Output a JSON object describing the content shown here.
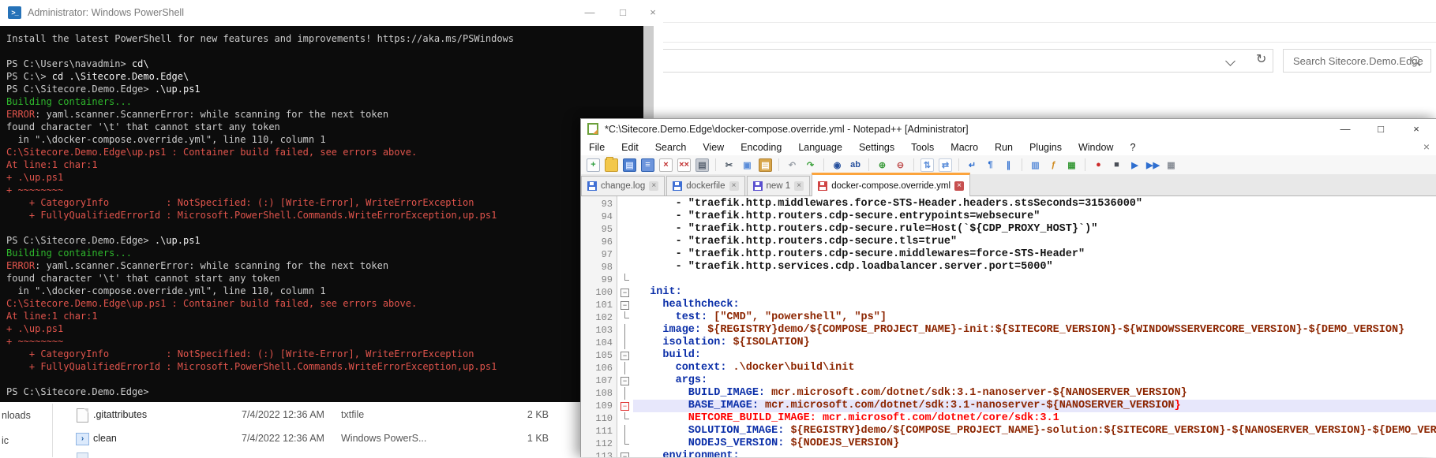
{
  "explorer_window": {
    "search_placeholder": "Search Sitecore.Demo.Edge",
    "refresh_icon_glyph": "↻",
    "nav_fragments": [
      "nloads",
      "ic"
    ],
    "files": [
      {
        "name": ".gitattributes",
        "date_modified": "7/4/2022 12:36 AM",
        "type": "txtfile",
        "size": "2 KB",
        "icon": "text-file-icon"
      },
      {
        "name": "clean",
        "date_modified": "7/4/2022 12:36 AM",
        "type": "Windows PowerS...",
        "size": "1 KB",
        "icon": "powershell-file-icon"
      }
    ]
  },
  "powershell_window": {
    "title": "Administrator: Windows PowerShell",
    "icon_glyph": ">_",
    "window_buttons": {
      "minimize": "—",
      "maximize": "□",
      "close": "×"
    },
    "console_lines": [
      [
        [
          "Install the latest PowerShell for new features and improvements! https://aka.ms/PSWindows",
          "w"
        ]
      ],
      [],
      [
        [
          "PS C:\\Users\\navadmin> ",
          "w"
        ],
        [
          "cd\\",
          "W"
        ]
      ],
      [
        [
          "PS C:\\> ",
          "w"
        ],
        [
          "cd .\\Sitecore.Demo.Edge\\",
          "W"
        ]
      ],
      [
        [
          "PS C:\\Sitecore.Demo.Edge> ",
          "w"
        ],
        [
          ".\\up.ps1",
          "W"
        ]
      ],
      [
        [
          "Building containers...",
          "g"
        ]
      ],
      [
        [
          "ERROR",
          "r"
        ],
        [
          ": yaml.scanner.ScannerError: while scanning for the next token",
          "w"
        ]
      ],
      [
        [
          "found character '\\t' that cannot start any token",
          "w"
        ]
      ],
      [
        [
          "  in \".\\docker-compose.override.yml\", line 110, column 1",
          "w"
        ]
      ],
      [
        [
          "C:\\Sitecore.Demo.Edge\\up.ps1 : Container build failed, see errors above.",
          "r"
        ]
      ],
      [
        [
          "At line:1 char:1",
          "r"
        ]
      ],
      [
        [
          "+ .\\up.ps1",
          "r"
        ]
      ],
      [
        [
          "+ ~~~~~~~~",
          "r"
        ]
      ],
      [
        [
          "    + CategoryInfo          : NotSpecified: (:) [Write-Error], WriteErrorException",
          "r"
        ]
      ],
      [
        [
          "    + FullyQualifiedErrorId : Microsoft.PowerShell.Commands.WriteErrorException,up.ps1",
          "r"
        ]
      ],
      [],
      [
        [
          "PS C:\\Sitecore.Demo.Edge> ",
          "w"
        ],
        [
          ".\\up.ps1",
          "W"
        ]
      ],
      [
        [
          "Building containers...",
          "g"
        ]
      ],
      [
        [
          "ERROR",
          "r"
        ],
        [
          ": yaml.scanner.ScannerError: while scanning for the next token",
          "w"
        ]
      ],
      [
        [
          "found character '\\t' that cannot start any token",
          "w"
        ]
      ],
      [
        [
          "  in \".\\docker-compose.override.yml\", line 110, column 1",
          "w"
        ]
      ],
      [
        [
          "C:\\Sitecore.Demo.Edge\\up.ps1 : Container build failed, see errors above.",
          "r"
        ]
      ],
      [
        [
          "At line:1 char:1",
          "r"
        ]
      ],
      [
        [
          "+ .\\up.ps1",
          "r"
        ]
      ],
      [
        [
          "+ ~~~~~~~~",
          "r"
        ]
      ],
      [
        [
          "    + CategoryInfo          : NotSpecified: (:) [Write-Error], WriteErrorException",
          "r"
        ]
      ],
      [
        [
          "    + FullyQualifiedErrorId : Microsoft.PowerShell.Commands.WriteErrorException,up.ps1",
          "r"
        ]
      ],
      [],
      [
        [
          "PS C:\\Sitecore.Demo.Edge>",
          "w"
        ]
      ]
    ]
  },
  "notepad_window": {
    "title": "*C:\\Sitecore.Demo.Edge\\docker-compose.override.yml - Notepad++ [Administrator]",
    "window_buttons": {
      "minimize": "—",
      "maximize": "□",
      "close": "×"
    },
    "menu_items": [
      "File",
      "Edit",
      "Search",
      "View",
      "Encoding",
      "Language",
      "Settings",
      "Tools",
      "Macro",
      "Run",
      "Plugins",
      "Window",
      "?"
    ],
    "menu_close_glyph": "×",
    "toolbar_icons": [
      {
        "name": "new-file-icon",
        "glyph": "+",
        "color": "#2e9e3e",
        "bg": "#fdfdfd",
        "border": "#a9b4c4"
      },
      {
        "name": "open-file-icon",
        "glyph": "",
        "color": "#fff",
        "bg": "#f3c84b",
        "border": "#c89b2a"
      },
      {
        "name": "save-icon",
        "glyph": "▤",
        "color": "#cfe0ff",
        "bg": "#4d7fd0",
        "border": "#2d5fb0"
      },
      {
        "name": "save-all-icon",
        "glyph": "≡",
        "color": "#fff",
        "bg": "#6d95dc",
        "border": "#2d5fb0"
      },
      {
        "name": "close-icon",
        "glyph": "×",
        "color": "#c23333",
        "bg": "#fff",
        "border": "#b9b9b9"
      },
      {
        "name": "close-all-icon",
        "glyph": "××",
        "color": "#c23333",
        "bg": "#fff",
        "border": "#b9b9b9"
      },
      {
        "name": "print-icon",
        "glyph": "▤",
        "color": "#5a6472",
        "bg": "#c9cdd4",
        "border": "#97a0ad"
      },
      {
        "sep": true
      },
      {
        "name": "cut-icon",
        "glyph": "✂",
        "color": "#44505e",
        "bg": "",
        "border": ""
      },
      {
        "name": "copy-icon",
        "glyph": "▣",
        "color": "#5b8dd9",
        "bg": "",
        "border": ""
      },
      {
        "name": "paste-icon",
        "glyph": "▤",
        "color": "#fff",
        "bg": "#d7a54a",
        "border": "#b08030"
      },
      {
        "sep": true
      },
      {
        "name": "undo-icon",
        "glyph": "↶",
        "color": "#9aa0a8",
        "bg": "",
        "border": ""
      },
      {
        "name": "redo-icon",
        "glyph": "↷",
        "color": "#3aa03a",
        "bg": "",
        "border": ""
      },
      {
        "sep": true
      },
      {
        "name": "find-icon",
        "glyph": "◉",
        "color": "#27519e",
        "bg": "",
        "border": ""
      },
      {
        "name": "replace-icon",
        "glyph": "ab",
        "color": "#27519e",
        "bg": "",
        "border": ""
      },
      {
        "sep": true
      },
      {
        "name": "zoom-in-icon",
        "glyph": "⊕",
        "color": "#3a9b3a",
        "bg": "",
        "border": ""
      },
      {
        "name": "zoom-out-icon",
        "glyph": "⊖",
        "color": "#c05050",
        "bg": "",
        "border": ""
      },
      {
        "sep": true
      },
      {
        "name": "sync-vertical-scroll-icon",
        "glyph": "⇅",
        "color": "#5b8dd9",
        "bg": "#fff",
        "border": "#c3cede"
      },
      {
        "name": "sync-horizontal-scroll-icon",
        "glyph": "⇄",
        "color": "#5b8dd9",
        "bg": "#fff",
        "border": "#c3cede"
      },
      {
        "sep": true
      },
      {
        "name": "word-wrap-icon",
        "glyph": "↵",
        "color": "#2f6fd0",
        "bg": "",
        "border": ""
      },
      {
        "name": "show-all-characters-icon",
        "glyph": "¶",
        "color": "#2f6fd0",
        "bg": "",
        "border": ""
      },
      {
        "name": "indent-guide-icon",
        "glyph": "∥",
        "color": "#2f6fd0",
        "bg": "",
        "border": ""
      },
      {
        "sep": true
      },
      {
        "name": "document-map-icon",
        "glyph": "▥",
        "color": "#5b8dd9",
        "bg": "",
        "border": ""
      },
      {
        "name": "function-list-icon",
        "glyph": "ƒ",
        "color": "#d08a1e",
        "bg": "",
        "border": ""
      },
      {
        "name": "folder-as-workspace-icon",
        "glyph": "▦",
        "color": "#3a9b3a",
        "bg": "",
        "border": ""
      },
      {
        "sep": true
      },
      {
        "name": "record-macro-icon",
        "glyph": "●",
        "color": "#cc2a2a",
        "bg": "",
        "border": ""
      },
      {
        "name": "stop-macro-icon",
        "glyph": "■",
        "color": "#4a4f57",
        "bg": "",
        "border": ""
      },
      {
        "name": "playback-macro-icon",
        "glyph": "▶",
        "color": "#2f6fd0",
        "bg": "",
        "border": ""
      },
      {
        "name": "run-macro-multiple-icon",
        "glyph": "▶▶",
        "color": "#2f6fd0",
        "bg": "",
        "border": ""
      },
      {
        "name": "save-macro-icon",
        "glyph": "▦",
        "color": "#8a8f97",
        "bg": "",
        "border": ""
      }
    ],
    "tabs": [
      {
        "label": "change.log",
        "active": false,
        "floppy_color": "#3f6fd4",
        "close_glyph": "×"
      },
      {
        "label": "dockerfile",
        "active": false,
        "floppy_color": "#3f6fd4",
        "close_glyph": "×"
      },
      {
        "label": "new 1",
        "active": false,
        "floppy_color": "#5a4fcf",
        "close_glyph": "×"
      },
      {
        "label": "docker-compose.override.yml",
        "active": true,
        "floppy_color": "#d04444",
        "close_glyph": "×"
      }
    ],
    "editor": {
      "lines": [
        {
          "n": "93",
          "marker": "",
          "hl": false,
          "seg": [
            [
              "      - \"traefik.http.middlewares.force-STS-Header.headers.stsSeconds=31536000\"",
              "d"
            ]
          ]
        },
        {
          "n": "94",
          "marker": "",
          "hl": false,
          "seg": [
            [
              "      - \"traefik.http.routers.cdp-secure.entrypoints=websecure\"",
              "d"
            ]
          ]
        },
        {
          "n": "95",
          "marker": "",
          "hl": false,
          "seg": [
            [
              "      - \"traefik.http.routers.cdp-secure.rule=Host(`${CDP_PROXY_HOST}`)\"",
              "d"
            ]
          ]
        },
        {
          "n": "96",
          "marker": "",
          "hl": false,
          "seg": [
            [
              "      - \"traefik.http.routers.cdp-secure.tls=true\"",
              "d"
            ]
          ]
        },
        {
          "n": "97",
          "marker": "",
          "hl": false,
          "seg": [
            [
              "      - \"traefik.http.routers.cdp-secure.middlewares=force-STS-Header\"",
              "d"
            ]
          ]
        },
        {
          "n": "98",
          "marker": "",
          "hl": false,
          "seg": [
            [
              "      - \"traefik.http.services.cdp.loadbalancer.server.port=5000\"",
              "d"
            ]
          ]
        },
        {
          "n": "99",
          "marker": "tick",
          "hl": false,
          "seg": []
        },
        {
          "n": "100",
          "marker": "box",
          "hl": false,
          "seg": [
            [
              "  init:",
              "k"
            ]
          ]
        },
        {
          "n": "101",
          "marker": "box",
          "hl": false,
          "seg": [
            [
              "    healthcheck:",
              "k"
            ]
          ]
        },
        {
          "n": "102",
          "marker": "tick",
          "hl": false,
          "seg": [
            [
              "      test:",
              "k"
            ],
            [
              " [\"CMD\", \"powershell\", \"ps\"]",
              "v"
            ]
          ]
        },
        {
          "n": "103",
          "marker": "line",
          "hl": false,
          "seg": [
            [
              "    image:",
              "k"
            ],
            [
              " ${REGISTRY}demo/${COMPOSE_PROJECT_NAME}-init:${SITECORE_VERSION}-${WINDOWSSERVERCORE_VERSION}-${DEMO_VERSION}",
              "v"
            ]
          ]
        },
        {
          "n": "104",
          "marker": "line",
          "hl": false,
          "seg": [
            [
              "    isolation:",
              "k"
            ],
            [
              " ${ISOLATION}",
              "v"
            ]
          ]
        },
        {
          "n": "105",
          "marker": "box",
          "hl": false,
          "seg": [
            [
              "    build:",
              "k"
            ]
          ]
        },
        {
          "n": "106",
          "marker": "line",
          "hl": false,
          "seg": [
            [
              "      context:",
              "k"
            ],
            [
              " .\\docker\\build\\init",
              "v"
            ]
          ]
        },
        {
          "n": "107",
          "marker": "box",
          "hl": false,
          "seg": [
            [
              "      args:",
              "k"
            ]
          ]
        },
        {
          "n": "108",
          "marker": "line",
          "hl": false,
          "seg": [
            [
              "        BUILD_IMAGE:",
              "k"
            ],
            [
              " mcr.microsoft.com/dotnet/sdk:3.1-nanoserver-${NANOSERVER_VERSION}",
              "v"
            ]
          ]
        },
        {
          "n": "109",
          "marker": "boxred",
          "hl": true,
          "seg": [
            [
              "        BASE_IMAGE:",
              "k"
            ],
            [
              " mcr.microsoft.com/dotnet/sdk:3.1-nanoserver-${NANOSERVER_VERSION",
              "v"
            ],
            [
              "}",
              "e"
            ]
          ]
        },
        {
          "n": "110",
          "marker": "tick",
          "hl": false,
          "seg": [
            [
              "        NETCORE_BUILD_IMAGE: mcr.microsoft.com/dotnet/core/sdk:3.1",
              "e"
            ]
          ]
        },
        {
          "n": "111",
          "marker": "line",
          "hl": false,
          "seg": [
            [
              "        SOLUTION_IMAGE:",
              "k"
            ],
            [
              " ${REGISTRY}demo/${COMPOSE_PROJECT_NAME}-solution:${SITECORE_VERSION}-${NANOSERVER_VERSION}-${DEMO_VERSION}",
              "v"
            ]
          ]
        },
        {
          "n": "112",
          "marker": "tick",
          "hl": false,
          "seg": [
            [
              "        NODEJS_VERSION:",
              "k"
            ],
            [
              " ${NODEJS_VERSION}",
              "v"
            ]
          ]
        },
        {
          "n": "113",
          "marker": "box",
          "hl": false,
          "seg": [
            [
              "    environment:",
              "k"
            ]
          ]
        }
      ]
    }
  }
}
